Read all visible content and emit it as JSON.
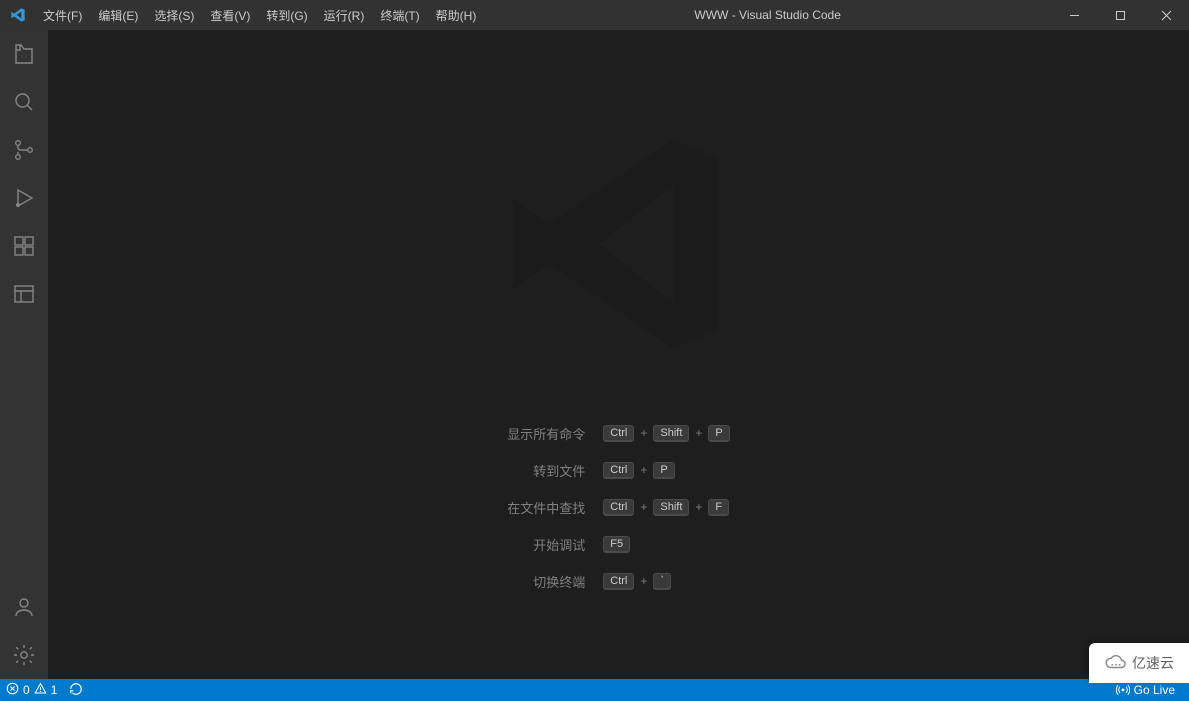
{
  "titlebar": {
    "title": "WWW - Visual Studio Code",
    "menu": [
      "文件(F)",
      "编辑(E)",
      "选择(S)",
      "查看(V)",
      "转到(G)",
      "运行(R)",
      "终端(T)",
      "帮助(H)"
    ]
  },
  "activitybar": {
    "top_icons": [
      "explorer-icon",
      "search-icon",
      "source-control-icon",
      "run-debug-icon",
      "extensions-icon",
      "preview-icon"
    ],
    "bottom_icons": [
      "account-icon",
      "settings-gear-icon"
    ]
  },
  "welcome": {
    "shortcuts": [
      {
        "label": "显示所有命令",
        "keys": [
          "Ctrl",
          "Shift",
          "P"
        ]
      },
      {
        "label": "转到文件",
        "keys": [
          "Ctrl",
          "P"
        ]
      },
      {
        "label": "在文件中查找",
        "keys": [
          "Ctrl",
          "Shift",
          "F"
        ]
      },
      {
        "label": "开始调试",
        "keys": [
          "F5"
        ]
      },
      {
        "label": "切换终端",
        "keys": [
          "Ctrl",
          "`"
        ]
      }
    ]
  },
  "statusbar": {
    "errors": "0",
    "warnings": "1",
    "go_live": "Go Live",
    "broadcast_icon": "broadcast-icon"
  },
  "brand": {
    "text": "亿速云"
  }
}
